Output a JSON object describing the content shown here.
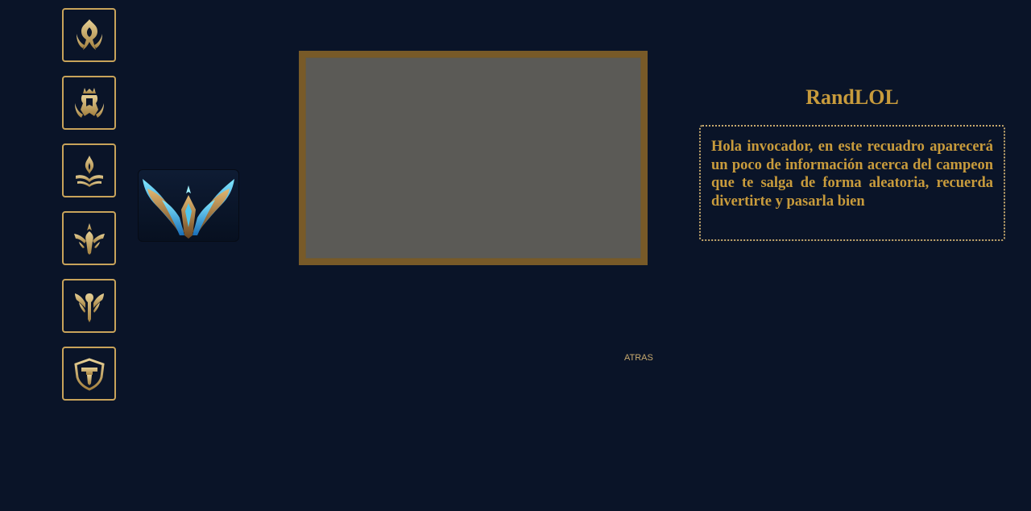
{
  "app": {
    "title": "RandLOL"
  },
  "roles": [
    {
      "name": "assassin-icon"
    },
    {
      "name": "fighter-icon"
    },
    {
      "name": "mage-icon"
    },
    {
      "name": "marksman-icon"
    },
    {
      "name": "support-icon"
    },
    {
      "name": "tank-icon"
    }
  ],
  "rank": {
    "emblem": "master-rank-emblem"
  },
  "champion": {
    "image": "champion-portrait-placeholder"
  },
  "nav": {
    "back_label": "ATRAS"
  },
  "info": {
    "text": "Hola invocador, en este recuadro aparecerá un poco de información acerca del campeon que te salga de forma aleatoria, recuerda divertirte y pasarla bien"
  },
  "colors": {
    "background": "#0a1428",
    "gold": "#c89b3c",
    "frame": "#785a28",
    "placeholder": "#5b5a56"
  }
}
